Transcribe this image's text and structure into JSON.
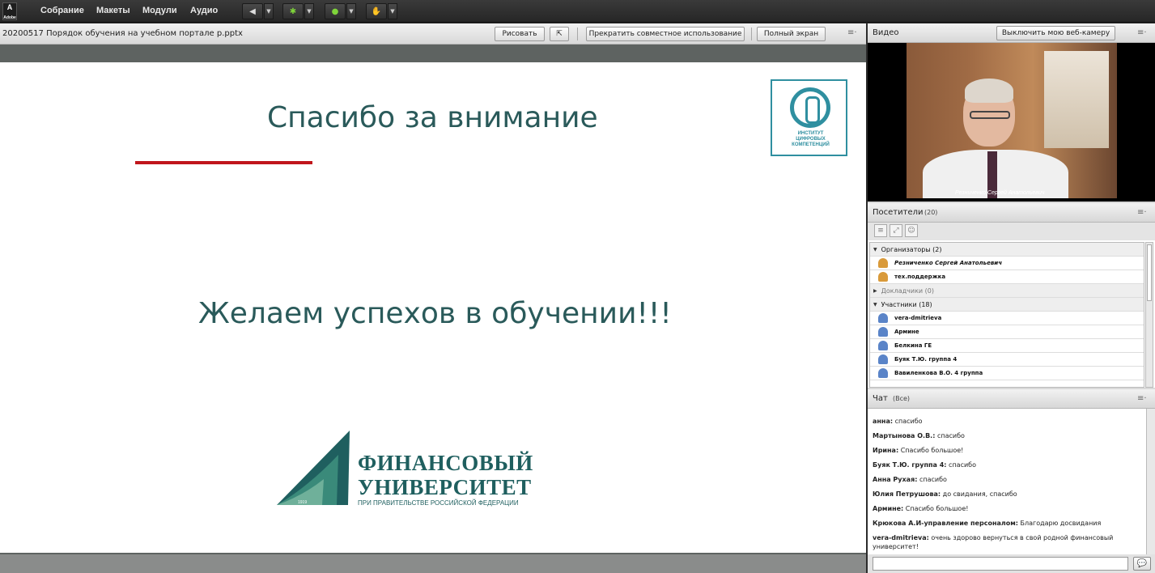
{
  "app": {
    "logo_text": "Adobe",
    "menu": [
      "Собрание",
      "Макеты",
      "Модули",
      "Аудио"
    ]
  },
  "share_pod": {
    "title": "20200517 Порядок обучения на учебном портале р.pptx",
    "draw_label": "Рисовать",
    "stop_sharing_label": "Прекратить совместное использование",
    "fullscreen_label": "Полный экран",
    "menu_glyph": "≡·"
  },
  "slide": {
    "title": "Спасибо за внимание",
    "wish": "Желаем успехов в обучении!!!",
    "institute_logo_text": "ИНСТИТУТ\nЦИФРОВЫХ\nКОМПЕТЕНЦИЙ",
    "university_name": "ФИНАНСОВЫЙ\nУНИВЕРСИТЕТ",
    "university_sub": "ПРИ ПРАВИТЕЛЬСТВЕ РОССИЙСКОЙ ФЕДЕРАЦИИ",
    "logo_year": "1919"
  },
  "video_pod": {
    "title": "Видео",
    "webcam_button": "Выключить мою веб-камеру",
    "caption": "Резниченко Сергей Анатольевич"
  },
  "attendees_pod": {
    "title": "Посетители",
    "count": "(20)",
    "groups": [
      {
        "label": "Организаторы (2)",
        "expanded": true,
        "members": [
          {
            "name": "Резниченко Сергей Анатольевич",
            "style": "italic"
          },
          {
            "name": "тех.поддержка",
            "style": "bold"
          }
        ]
      },
      {
        "label": "Докладчики (0)",
        "expanded": false,
        "members": []
      },
      {
        "label": "Участники (18)",
        "expanded": true,
        "members": [
          {
            "name": "vera-dmitrieva",
            "style": "bold"
          },
          {
            "name": "Армине",
            "style": "bold"
          },
          {
            "name": "Белкина ГЕ",
            "style": "bold"
          },
          {
            "name": "Буяк Т.Ю. группа 4",
            "style": "bold"
          },
          {
            "name": "Вавиленкова В.О. 4 группа",
            "style": "bold"
          }
        ]
      }
    ]
  },
  "chat_pod": {
    "title": "Чат",
    "scope": "(Все)",
    "messages": [
      {
        "who": "анна:",
        "text": " спасибо"
      },
      {
        "who": "Мартынова О.В.:",
        "text": " спасибо"
      },
      {
        "who": "Ирина:",
        "text": " Спасибо большое!"
      },
      {
        "who": "Буяк Т.Ю. группа 4:",
        "text": " спасибо"
      },
      {
        "who": "Анна Рухая:",
        "text": " спасибо"
      },
      {
        "who": "Юлия Петрушова:",
        "text": " до свидания, спасибо"
      },
      {
        "who": "Армине:",
        "text": " Спасибо большое!"
      },
      {
        "who": "Крюкова А.И-управление персоналом:",
        "text": " Благодарю досвидания"
      },
      {
        "who": "vera-dmitrieva:",
        "text": " очень здорово вернуться в свой родной финансовый университет!"
      }
    ],
    "input_value": ""
  },
  "colors": {
    "slide_teal": "#2a5a5a",
    "accent_red": "#c0161c",
    "institute_blue": "#2f8fa0"
  }
}
